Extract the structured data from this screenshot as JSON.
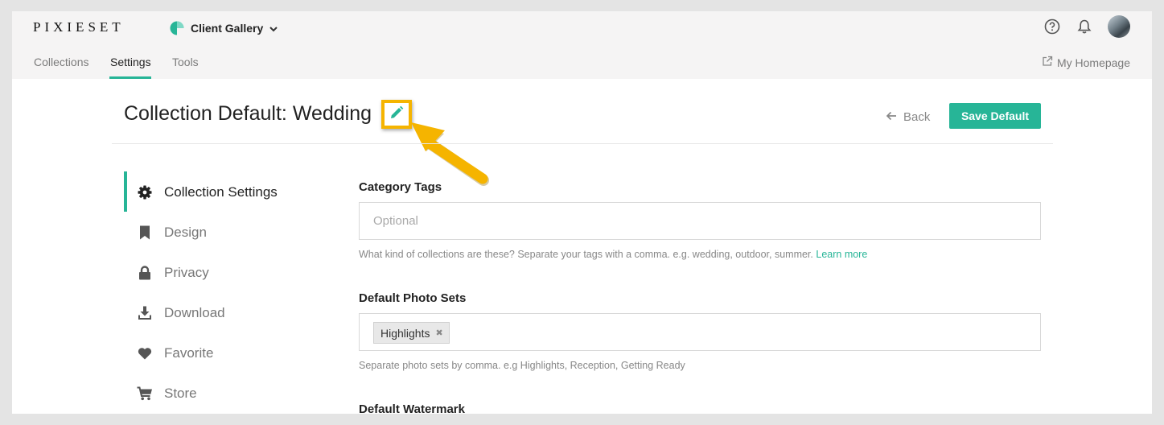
{
  "brand": {
    "name": "PIXIESET"
  },
  "app_switcher": {
    "label": "Client Gallery",
    "icon": "chevron-down-icon"
  },
  "header_icons": [
    "help-icon",
    "bell-icon",
    "avatar"
  ],
  "subnav": {
    "tabs": [
      {
        "label": "Collections",
        "active": false
      },
      {
        "label": "Settings",
        "active": true
      },
      {
        "label": "Tools",
        "active": false
      }
    ],
    "homepage_link": "My Homepage"
  },
  "page": {
    "title": "Collection Default: Wedding",
    "back_label": "Back",
    "save_label": "Save Default"
  },
  "sidebar": {
    "items": [
      {
        "label": "Collection Settings",
        "icon": "gear-icon",
        "active": true
      },
      {
        "label": "Design",
        "icon": "bookmark-icon",
        "active": false
      },
      {
        "label": "Privacy",
        "icon": "lock-icon",
        "active": false
      },
      {
        "label": "Download",
        "icon": "download-icon",
        "active": false
      },
      {
        "label": "Favorite",
        "icon": "heart-icon",
        "active": false
      },
      {
        "label": "Store",
        "icon": "cart-icon",
        "active": false
      }
    ]
  },
  "form": {
    "category_tags": {
      "label": "Category Tags",
      "placeholder": "Optional",
      "help": "What kind of collections are these? Separate your tags with a comma. e.g. wedding, outdoor, summer.",
      "help_link": "Learn more"
    },
    "photo_sets": {
      "label": "Default Photo Sets",
      "chips": [
        "Highlights"
      ],
      "help": "Separate photo sets by comma. e.g Highlights, Reception, Getting Ready"
    },
    "watermark": {
      "label": "Default Watermark"
    }
  },
  "colors": {
    "accent": "#27b597",
    "highlight": "#f5b400"
  }
}
